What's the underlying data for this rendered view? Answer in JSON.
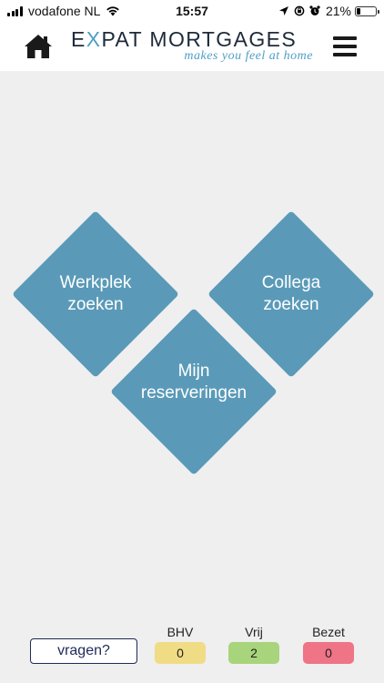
{
  "status_bar": {
    "carrier": "vodafone NL",
    "time": "15:57",
    "battery_percent": "21%",
    "battery_level": 0.21,
    "icons": [
      "signal-icon",
      "wifi-icon",
      "location-icon",
      "orientation-lock-icon",
      "alarm-icon",
      "battery-icon"
    ]
  },
  "header": {
    "logo_prefix": "E",
    "logo_x": "X",
    "logo_rest": "PAT MORTGAGES",
    "tagline": "makes you feel at home",
    "home_icon": "home-icon",
    "menu_icon": "hamburger-menu-icon"
  },
  "tiles": {
    "workplace": {
      "line1": "Werkplek",
      "line2": "zoeken"
    },
    "colleague": {
      "line1": "Collega",
      "line2": "zoeken"
    },
    "reservations": {
      "line1": "Mijn",
      "line2": "reserveringen"
    }
  },
  "footer": {
    "ask_label": "vragen?",
    "stats": {
      "bhv": {
        "label": "BHV",
        "value": "0",
        "color": "#f1dc86"
      },
      "free": {
        "label": "Vrij",
        "value": "2",
        "color": "#a8d47c"
      },
      "occupied": {
        "label": "Bezet",
        "value": "0",
        "color": "#ee7486"
      }
    }
  },
  "colors": {
    "tile": "#5a9ab8",
    "background": "#efefef",
    "accent": "#4e9fc7",
    "brand_dark": "#1e2a3a"
  }
}
